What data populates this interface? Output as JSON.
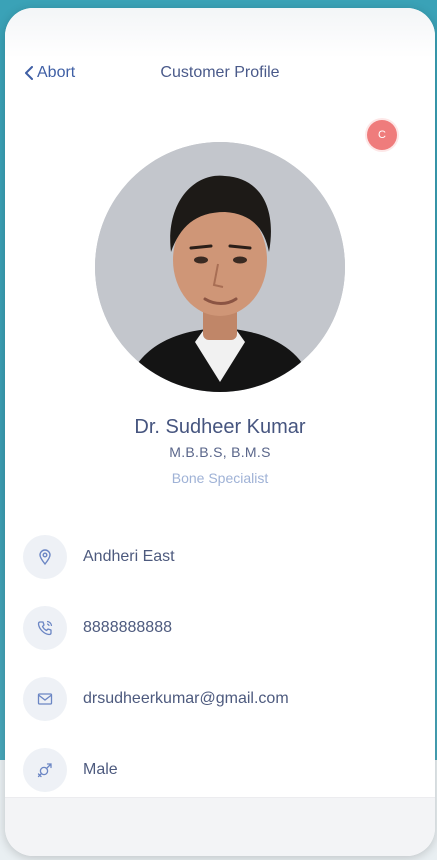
{
  "header": {
    "back_label": "Abort",
    "title": "Customer Profile"
  },
  "badge": {
    "letter": "C",
    "color": "#ef7c7c"
  },
  "profile": {
    "name": "Dr. Sudheer Kumar",
    "degree": "M.B.B.S, B.M.S",
    "specialty": "Bone Specialist"
  },
  "info": {
    "location": {
      "icon": "location-pin-icon",
      "text": "Andheri East"
    },
    "phone": {
      "icon": "phone-icon",
      "text": "8888888888"
    },
    "email": {
      "icon": "mail-icon",
      "text": "drsudheerkumar@gmail.com"
    },
    "gender": {
      "icon": "gender-icon",
      "text": "Male"
    }
  },
  "colors": {
    "accent": "#3f5fa5",
    "background": "#3aa2b7",
    "specialty": "#9fb2d6"
  }
}
